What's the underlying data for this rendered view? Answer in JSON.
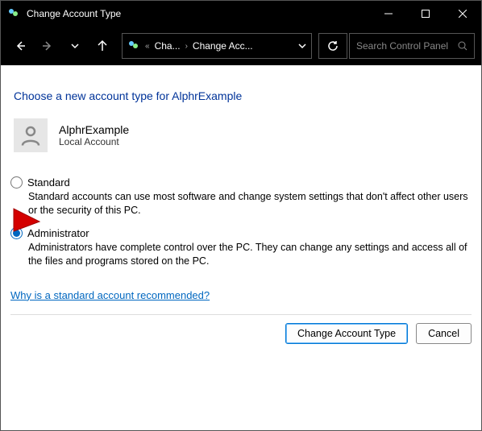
{
  "titlebar": {
    "title": "Change Account Type"
  },
  "navbar": {
    "breadcrumb": {
      "pre": "«",
      "c1": "Cha...",
      "c2": "Change Acc..."
    },
    "search_placeholder": "Search Control Panel"
  },
  "content": {
    "heading": "Choose a new account type for AlphrExample",
    "user": {
      "name": "AlphrExample",
      "type": "Local Account"
    },
    "options": {
      "standard": {
        "label": "Standard",
        "desc": "Standard accounts can use most software and change system settings that don't affect other users or the security of this PC."
      },
      "admin": {
        "label": "Administrator",
        "desc": "Administrators have complete control over the PC. They can change any settings and access all of the files and programs stored on the PC."
      }
    },
    "help_link": "Why is a standard account recommended?",
    "buttons": {
      "primary": "Change Account Type",
      "cancel": "Cancel"
    }
  }
}
